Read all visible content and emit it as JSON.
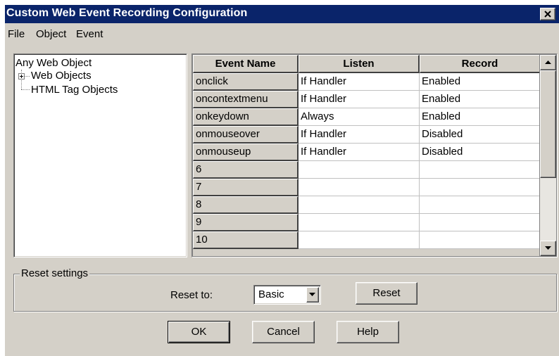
{
  "window": {
    "title": "Custom Web Event Recording Configuration"
  },
  "menu": [
    "File",
    "Object",
    "Event"
  ],
  "tree": {
    "root": "Any Web Object",
    "children": [
      "Web Objects",
      "HTML Tag Objects"
    ]
  },
  "grid": {
    "headers": [
      "Event Name",
      "Listen",
      "Record"
    ],
    "rows": [
      {
        "name": "onclick",
        "listen": "If Handler",
        "record": "Enabled"
      },
      {
        "name": "oncontextmenu",
        "listen": "If Handler",
        "record": "Enabled"
      },
      {
        "name": "onkeydown",
        "listen": "Always",
        "record": "Enabled"
      },
      {
        "name": "onmouseover",
        "listen": "If Handler",
        "record": "Disabled"
      },
      {
        "name": "onmouseup",
        "listen": "If Handler",
        "record": "Disabled"
      },
      {
        "name": "6",
        "listen": "",
        "record": ""
      },
      {
        "name": "7",
        "listen": "",
        "record": ""
      },
      {
        "name": "8",
        "listen": "",
        "record": ""
      },
      {
        "name": "9",
        "listen": "",
        "record": ""
      },
      {
        "name": "10",
        "listen": "",
        "record": ""
      }
    ]
  },
  "reset": {
    "group_label": "Reset settings",
    "reset_to_label": "Reset to:",
    "combo_value": "Basic",
    "reset_button": "Reset"
  },
  "buttons": {
    "ok": "OK",
    "cancel": "Cancel",
    "help": "Help"
  },
  "icons": {
    "close": "close-icon",
    "scroll_up": "arrow-up-icon",
    "scroll_down": "arrow-down-icon",
    "combo_dropdown": "chevron-down-icon",
    "tree_expand": "plus-expander-icon"
  },
  "colors": {
    "titlebar": "#0a246a",
    "face": "#d4d0c8"
  }
}
